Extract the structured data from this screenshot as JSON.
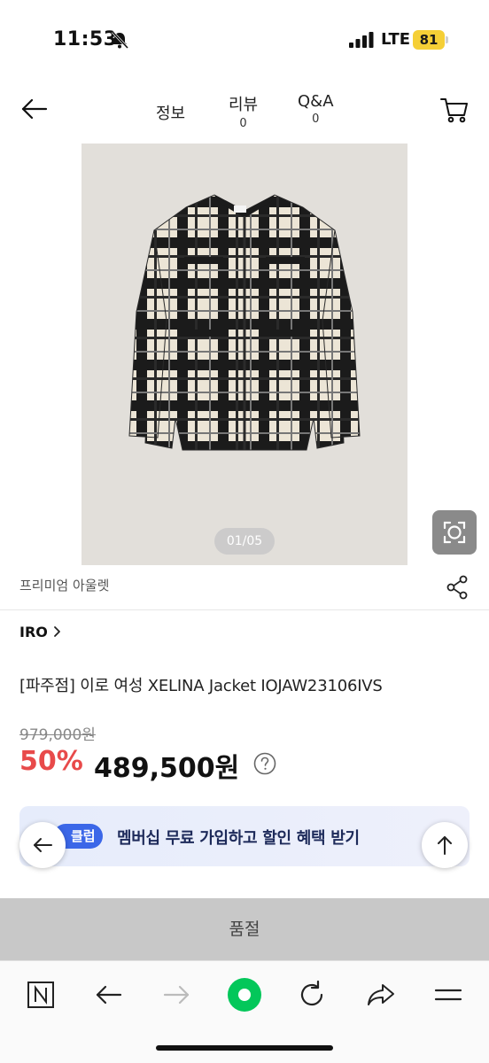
{
  "status_bar": {
    "time": "11:53",
    "network": "LTE",
    "battery": "81"
  },
  "header": {
    "tabs": [
      {
        "label": "정보",
        "count": ""
      },
      {
        "label": "리뷰",
        "count": "0"
      },
      {
        "label": "Q&A",
        "count": "0"
      }
    ]
  },
  "gallery": {
    "counter": "01/05"
  },
  "seller_label": "프리미엄 아울렛",
  "brand": "IRO",
  "product_title": "[파주점] 이로 여성 XELINA Jacket IOJAW23106IVS",
  "pricing": {
    "original_price": "979,000원",
    "discount": "50%",
    "sale_price": "489,500원"
  },
  "membership_banner": {
    "badge": "클럽",
    "text": "멤버십 무료 가입하고 할인 혜택 받기"
  },
  "soldout_label": "품절",
  "colors": {
    "accent_red": "#e84a4a",
    "banner_badge": "#3b67e8",
    "naver_green": "#03c75a",
    "battery": "#f5cf36"
  },
  "browser_toolbar": {
    "icons": [
      "naver-n-icon",
      "back-arrow-icon",
      "forward-arrow-icon",
      "green-home-icon",
      "reload-icon",
      "share-arrow-icon",
      "menu-icon"
    ]
  }
}
